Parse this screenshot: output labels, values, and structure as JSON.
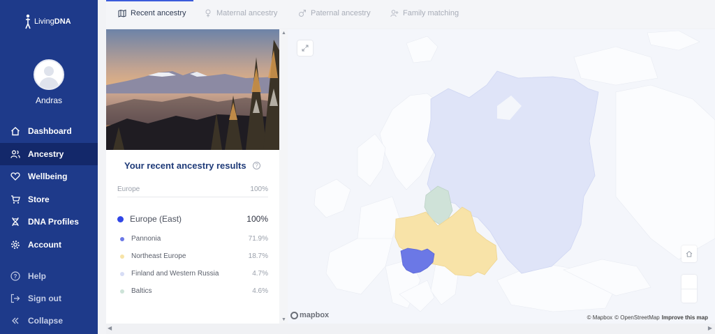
{
  "sidebar": {
    "logo_prefix": "Living",
    "logo_bold": "DNA",
    "username": "Andras",
    "nav": [
      {
        "label": "Dashboard",
        "icon": "home-icon"
      },
      {
        "label": "Ancestry",
        "icon": "users-icon",
        "active": true
      },
      {
        "label": "Wellbeing",
        "icon": "heart-icon"
      },
      {
        "label": "Store",
        "icon": "cart-icon"
      },
      {
        "label": "DNA Profiles",
        "icon": "dna-icon"
      },
      {
        "label": "Account",
        "icon": "gear-icon"
      }
    ],
    "footer": [
      {
        "label": "Help",
        "icon": "help-circle-icon"
      },
      {
        "label": "Sign out",
        "icon": "sign-out-icon"
      },
      {
        "label": "Collapse",
        "icon": "collapse-icon"
      }
    ]
  },
  "tabs": [
    {
      "label": "Recent ancestry",
      "icon": "map-icon",
      "active": true
    },
    {
      "label": "Maternal ancestry",
      "icon": "female-icon"
    },
    {
      "label": "Paternal ancestry",
      "icon": "male-icon"
    },
    {
      "label": "Family matching",
      "icon": "user-plus-icon"
    }
  ],
  "results": {
    "title": "Your recent ancestry results",
    "top_region": {
      "label": "Europe",
      "pct": "100%"
    },
    "main": {
      "label": "Europe (East)",
      "pct": "100%",
      "color": "#3046e6"
    },
    "sub": [
      {
        "label": "Pannonia",
        "pct": "71.9%",
        "color": "#6b78e6"
      },
      {
        "label": "Northeast Europe",
        "pct": "18.7%",
        "color": "#f7e3a6"
      },
      {
        "label": "Finland and Western Russia",
        "pct": "4.7%",
        "color": "#d6dcf5"
      },
      {
        "label": "Baltics",
        "pct": "4.6%",
        "color": "#cde3d8"
      }
    ]
  },
  "map": {
    "mapbox_label": "mapbox",
    "attribution_1": "© Mapbox",
    "attribution_2": "© OpenStreetMap",
    "attribution_3": "Improve this map"
  }
}
